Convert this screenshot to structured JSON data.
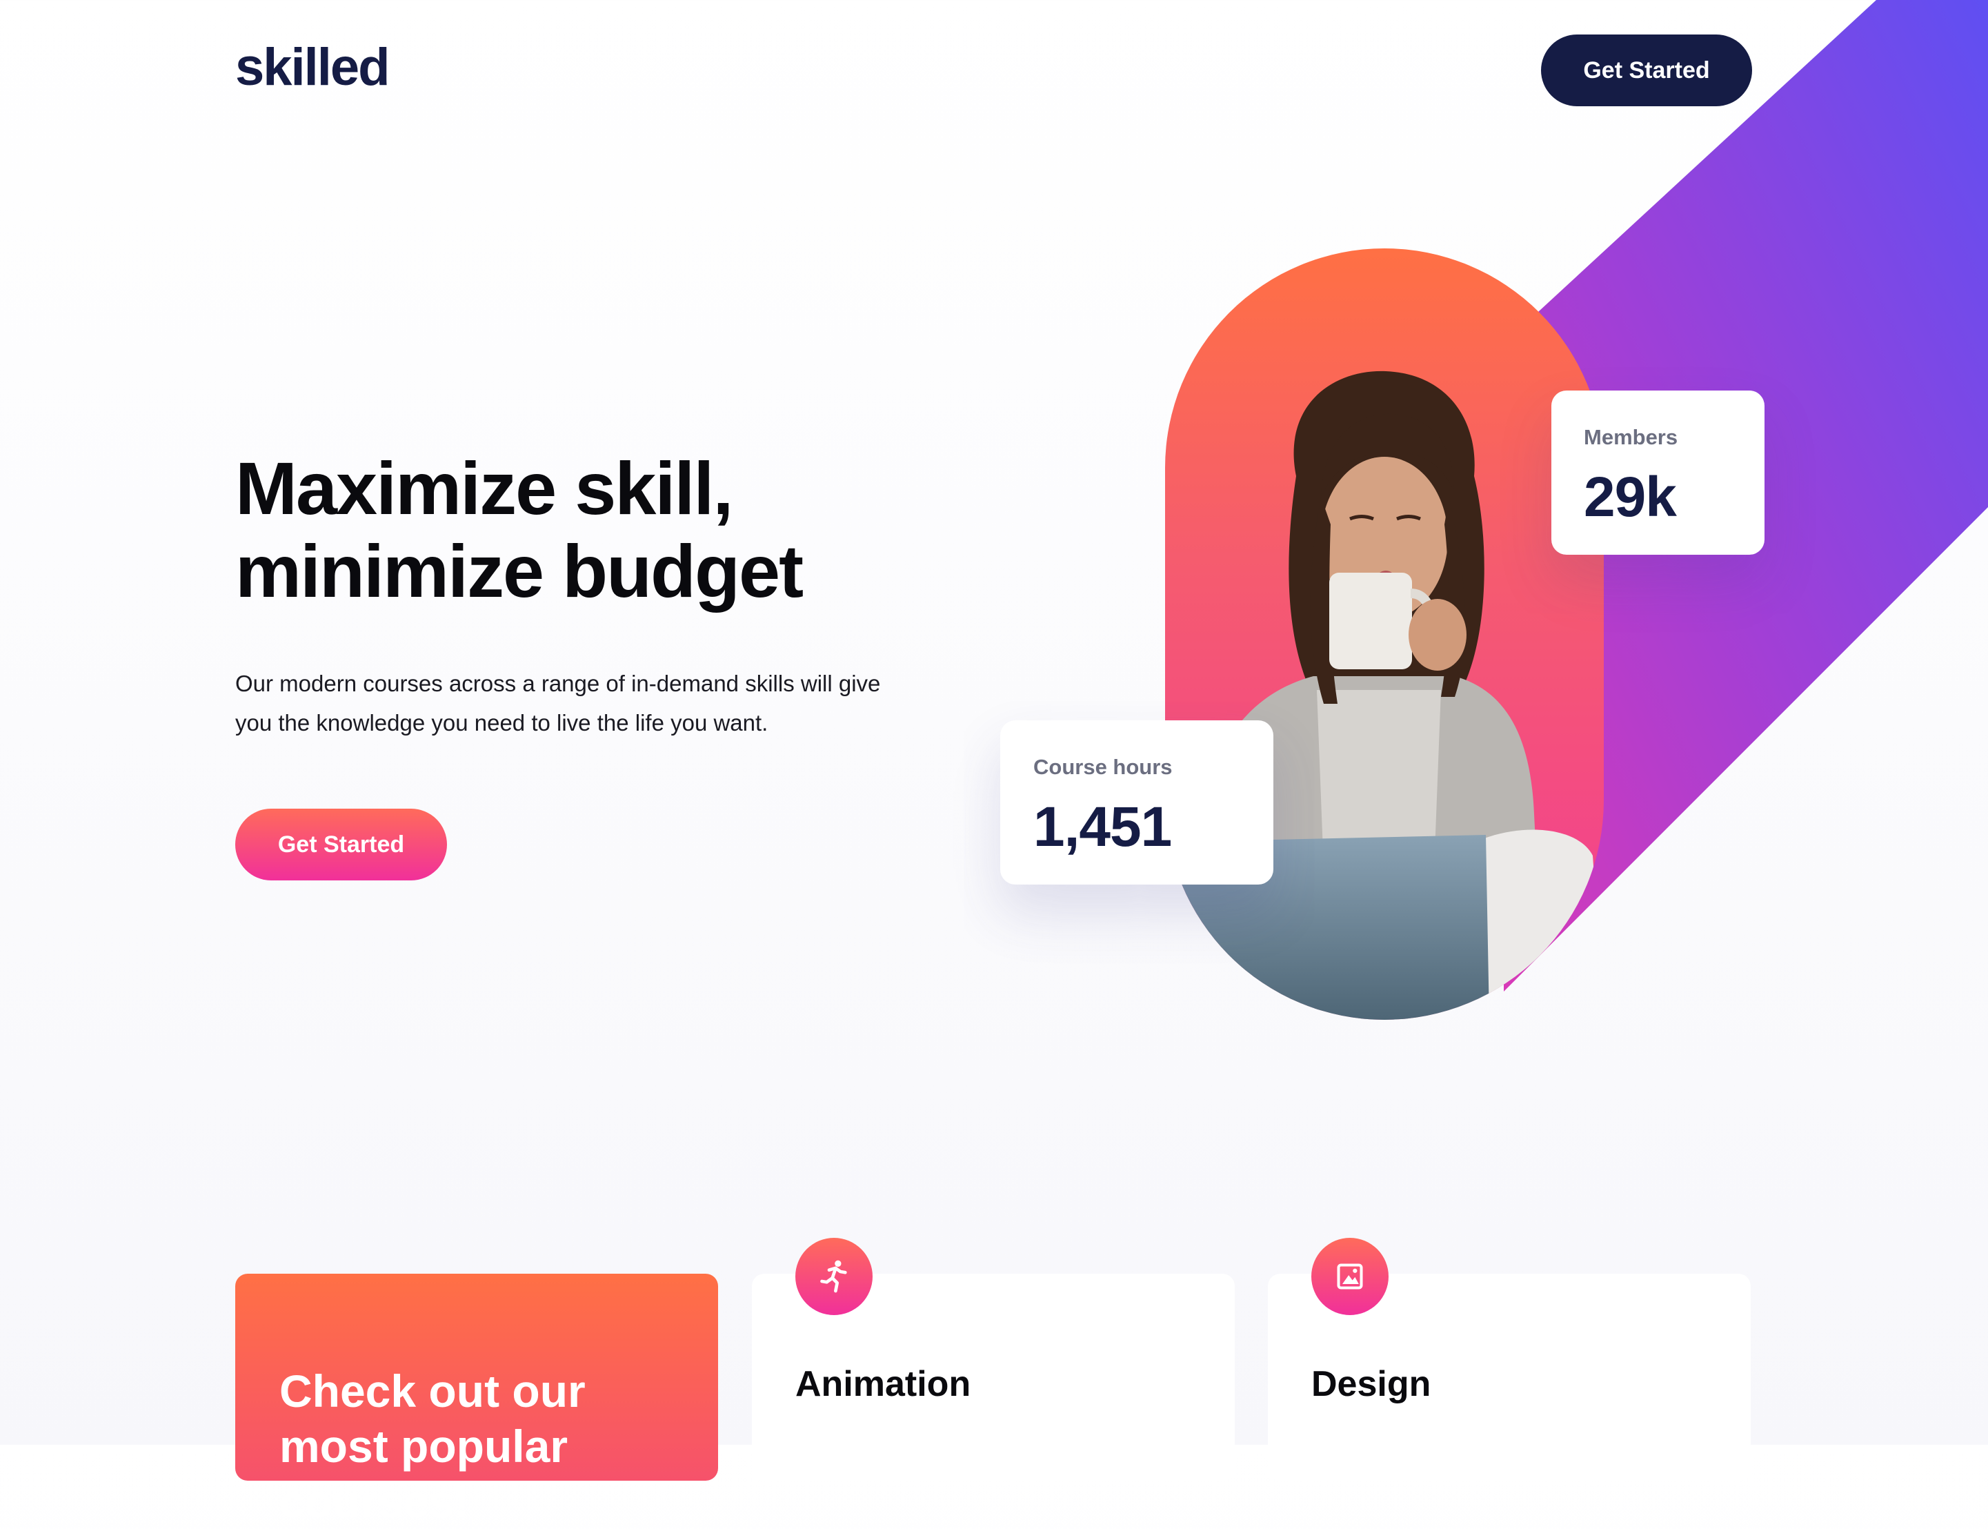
{
  "brand": {
    "name": "skilled"
  },
  "nav": {
    "cta_label": "Get Started"
  },
  "hero": {
    "title_line1": "Maximize skill,",
    "title_line2": "minimize budget",
    "description": "Our modern courses across a range of in-demand skills will give you the knowledge you need to live the life you want.",
    "cta_label": "Get Started"
  },
  "stats": {
    "members": {
      "label": "Members",
      "value": "29k"
    },
    "course_hours": {
      "label": "Course hours",
      "value": "1,451"
    }
  },
  "courses": {
    "promo_title": "Check out our most popular courses!",
    "items": [
      {
        "title": "Animation",
        "icon": "running-figure-icon"
      },
      {
        "title": "Design",
        "icon": "image-frame-icon"
      }
    ]
  },
  "colors": {
    "navy": "#151c45",
    "gradient_orange": "#ff6b5b",
    "gradient_pink": "#f1309a",
    "gradient_purple": "#6a4cf0"
  }
}
